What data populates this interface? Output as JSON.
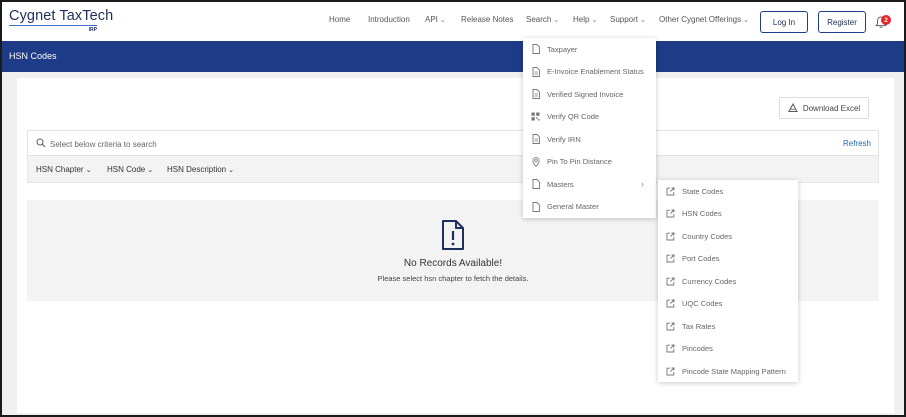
{
  "brand": {
    "name_bold": "Cygnet",
    "name_light": " TaxTech",
    "sub": "IRP"
  },
  "nav": [
    {
      "label": "Home",
      "has_chevron": false
    },
    {
      "label": "Introduction",
      "has_chevron": false
    },
    {
      "label": "API",
      "has_chevron": true
    },
    {
      "label": "Release Notes",
      "has_chevron": false
    },
    {
      "label": "Search",
      "has_chevron": true
    },
    {
      "label": "Help",
      "has_chevron": true
    },
    {
      "label": "Support",
      "has_chevron": true
    },
    {
      "label": "Other Cygnet Offerings",
      "has_chevron": true
    }
  ],
  "auth": {
    "login_label": "Log In",
    "register_label": "Register"
  },
  "notifications": {
    "count": "2"
  },
  "page": {
    "title": "HSN Codes",
    "download_label": "Download Excel"
  },
  "search": {
    "placeholder": "Select below criteria to search",
    "refresh_label": "Refresh"
  },
  "filters": [
    "HSN Chapter",
    "HSN Code",
    "HSN Description"
  ],
  "empty_state": {
    "title": "No Records Available!",
    "message": "Please select hsn chapter to fetch the details."
  },
  "search_menu": [
    {
      "label": "Taxpayer",
      "icon": "file-icon"
    },
    {
      "label": "E-Invoice Enablement Status",
      "icon": "file-lines-icon"
    },
    {
      "label": "Verified Signed Invoice",
      "icon": "file-lines-icon"
    },
    {
      "label": "Verify QR Code",
      "icon": "qr-code-icon"
    },
    {
      "label": "Verify IRN",
      "icon": "file-lines-icon"
    },
    {
      "label": "Pin To Pin Distance",
      "icon": "map-pin-icon"
    },
    {
      "label": "Masters",
      "icon": "file-icon",
      "has_submenu": true
    },
    {
      "label": "General Master",
      "icon": "file-icon"
    }
  ],
  "masters_submenu": [
    "State Codes",
    "HSN Codes",
    "Country Codes",
    "Port Codes",
    "Currency Codes",
    "UQC Codes",
    "Tax Rates",
    "Pincodes",
    "Pincode State Mapping Pattern"
  ],
  "colors": {
    "primary": "#1e3b87",
    "link": "#2466b4",
    "badge": "#e8232a"
  }
}
